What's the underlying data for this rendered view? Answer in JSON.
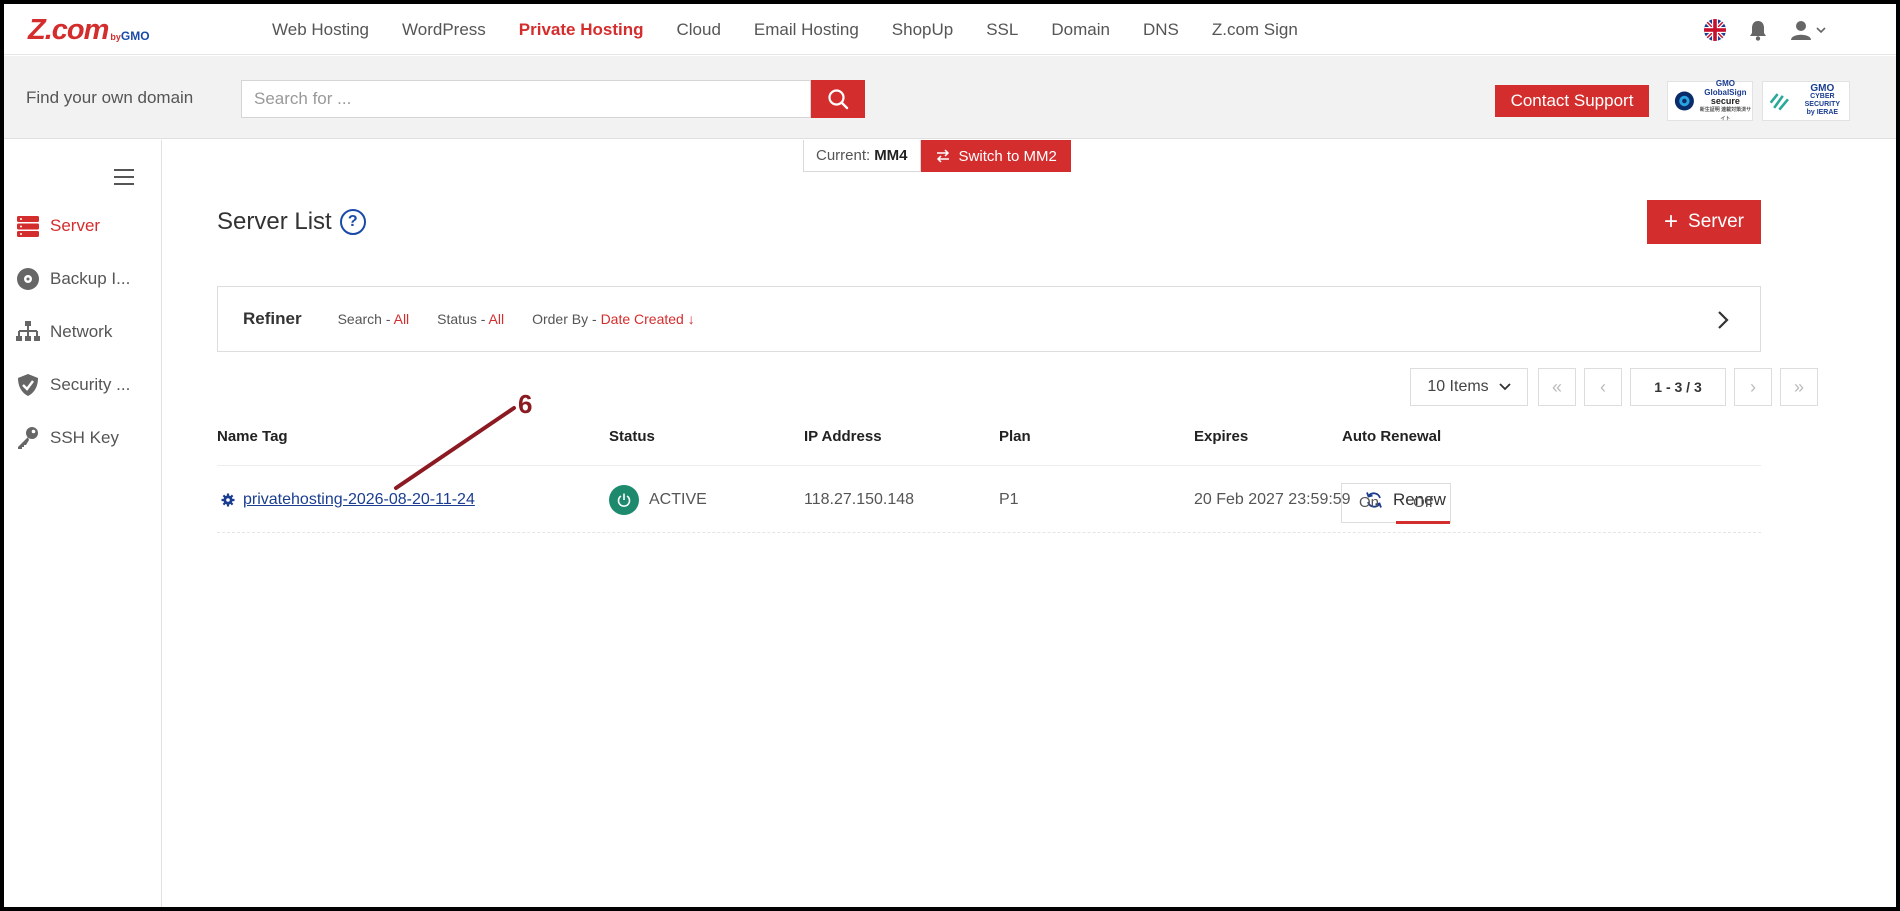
{
  "brand": {
    "logo": "Z.com",
    "logo_by": "by",
    "logo_gmo": "GMO"
  },
  "nav": {
    "links": [
      {
        "label": "Web Hosting",
        "active": false
      },
      {
        "label": "WordPress",
        "active": false
      },
      {
        "label": "Private Hosting",
        "active": true
      },
      {
        "label": "Cloud",
        "active": false
      },
      {
        "label": "Email Hosting",
        "active": false
      },
      {
        "label": "ShopUp",
        "active": false
      },
      {
        "label": "SSL",
        "active": false
      },
      {
        "label": "Domain",
        "active": false
      },
      {
        "label": "DNS",
        "active": false
      },
      {
        "label": "Z.com Sign",
        "active": false
      }
    ],
    "icons": [
      "uk-flag-icon",
      "bell-icon",
      "user-icon",
      "chevron-down-icon"
    ]
  },
  "search": {
    "label": "Find your own domain",
    "placeholder": "Search for ...",
    "value": ""
  },
  "contact_label": "Contact Support",
  "badges": {
    "globalsign": {
      "line1": "GMO",
      "line2": "GlobalSign",
      "line3": "secure",
      "line4": "新生証明 連載対策済サイト"
    },
    "ierae": {
      "line1": "GMO",
      "line2": "CYBER SECURITY",
      "line3": "by IERAE"
    }
  },
  "sidebar": {
    "items": [
      {
        "label": "Server",
        "icon": "server-icon",
        "active": true
      },
      {
        "label": "Backup I...",
        "icon": "disc-icon",
        "active": false
      },
      {
        "label": "Network",
        "icon": "network-icon",
        "active": false
      },
      {
        "label": "Security ...",
        "icon": "shield-icon",
        "active": false
      },
      {
        "label": "SSH Key",
        "icon": "key-icon",
        "active": false
      }
    ]
  },
  "mm": {
    "current_label": "Current:",
    "current_value": "MM4",
    "switch_label": "Switch to MM2"
  },
  "page": {
    "title": "Server List",
    "help": "?",
    "add_label": "Server",
    "add_plus": "+"
  },
  "refiner": {
    "title": "Refiner",
    "search_label": "Search - ",
    "search_value": "All",
    "status_label": "Status - ",
    "status_value": "All",
    "order_label": "Order By - ",
    "order_value": "Date Created ↓"
  },
  "pagination": {
    "items_label": "10 Items",
    "info": "1 - 3 / 3"
  },
  "table": {
    "headers": [
      "Name Tag",
      "Status",
      "IP Address",
      "Plan",
      "Expires",
      "Auto Renewal"
    ],
    "rows": [
      {
        "name": "privatehosting-2026-08-20-11-24",
        "status": "ACTIVE",
        "ip": "118.27.150.148",
        "plan": "P1",
        "expires": "20 Feb 2027 23:59:59",
        "renew_label": "Renew",
        "auto_on": "On",
        "auto_off": "Off",
        "auto_selected": "Off"
      }
    ]
  },
  "annotation": {
    "number": "6",
    "color": "#8b1a22"
  },
  "colors": {
    "accent": "#d42d2d",
    "link": "#1a3d8f",
    "active_status": "#1d8a6d"
  }
}
